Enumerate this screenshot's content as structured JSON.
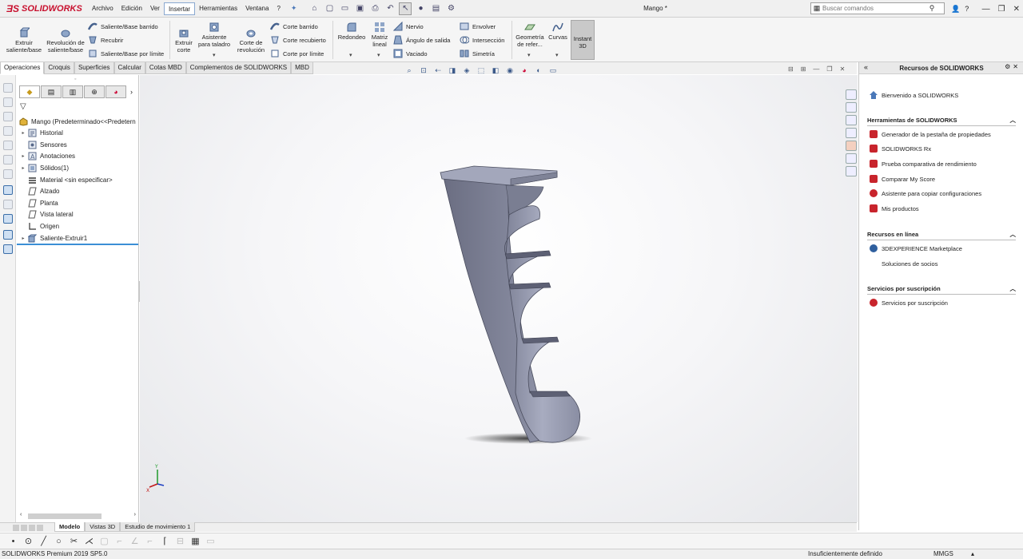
{
  "app": {
    "brand": "SOLIDWORKS",
    "document_title": "Mango *",
    "menus": [
      "Archivo",
      "Edición",
      "Ver",
      "Insertar",
      "Herramientas",
      "Ventana",
      "?"
    ],
    "active_menu": "Insertar",
    "search_placeholder": "Buscar comandos",
    "accent_color": "#c8102e"
  },
  "ribbon": {
    "extruir_saliente": "Extruir saliente/base",
    "revolucion_saliente": "Revolución de saliente/base",
    "saliente_barrido": "Saliente/Base barrido",
    "recubrir": "Recubrir",
    "saliente_limite": "Saliente/Base por límite",
    "extruir_corte": "Extruir corte",
    "asistente_taladro": "Asistente para taladro",
    "corte_revolucion": "Corte de revolución",
    "corte_barrido": "Corte barrido",
    "corte_recubierto": "Corte recubierto",
    "corte_limite": "Corte por límite",
    "redondeo": "Redondeo",
    "matriz_lineal": "Matriz lineal",
    "nervio": "Nervio",
    "angulo_salida": "Ángulo de salida",
    "vaciado": "Vaciado",
    "envolver": "Envolver",
    "interseccion": "Intersección",
    "simetria": "Simetría",
    "geometria_ref": "Geometría de refer...",
    "curvas": "Curvas",
    "instant3d": "Instant 3D"
  },
  "command_tabs": [
    "Operaciones",
    "Croquis",
    "Superficies",
    "Calcular",
    "Cotas MBD",
    "Complementos de SOLIDWORKS",
    "MBD"
  ],
  "feature_tree": {
    "root": "Mango  (Predeterminado<<Predetern",
    "items": [
      {
        "label": "Historial",
        "icon": "history-icon",
        "expandable": true
      },
      {
        "label": "Sensores",
        "icon": "sensor-icon",
        "expandable": false
      },
      {
        "label": "Anotaciones",
        "icon": "annotation-icon",
        "expandable": true
      },
      {
        "label": "Sólidos(1)",
        "icon": "solid-bodies-icon",
        "expandable": true
      },
      {
        "label": "Material <sin especificar>",
        "icon": "material-icon",
        "expandable": false
      },
      {
        "label": "Alzado",
        "icon": "plane-icon",
        "expandable": false
      },
      {
        "label": "Planta",
        "icon": "plane-icon",
        "expandable": false
      },
      {
        "label": "Vista lateral",
        "icon": "plane-icon",
        "expandable": false
      },
      {
        "label": "Origen",
        "icon": "origin-icon",
        "expandable": false
      },
      {
        "label": "Saliente-Extruir1",
        "icon": "extrude-icon",
        "expandable": true
      }
    ]
  },
  "task_pane": {
    "title": "Recursos de SOLIDWORKS",
    "welcome": "Bienvenido a SOLIDWORKS",
    "sections": [
      {
        "title": "Herramientas de SOLIDWORKS",
        "items": [
          "Generador de la pestaña de propiedades",
          "SOLIDWORKS Rx",
          "Prueba comparativa de rendimiento",
          "Comparar My Score",
          "Asistente para copiar configuraciones",
          "Mis productos"
        ]
      },
      {
        "title": "Recursos en línea",
        "items": [
          "3DEXPERIENCE Marketplace",
          "Soluciones de socios"
        ]
      },
      {
        "title": "Servicios por suscripción",
        "items": [
          "Servicios por suscripción"
        ]
      }
    ]
  },
  "bottom_tabs": [
    "Modelo",
    "Vistas 3D",
    "Estudio de movimiento 1"
  ],
  "status": {
    "version": "SOLIDWORKS Premium 2019 SP5.0",
    "definition": "Insuficientemente definido",
    "units": "MMGS"
  }
}
